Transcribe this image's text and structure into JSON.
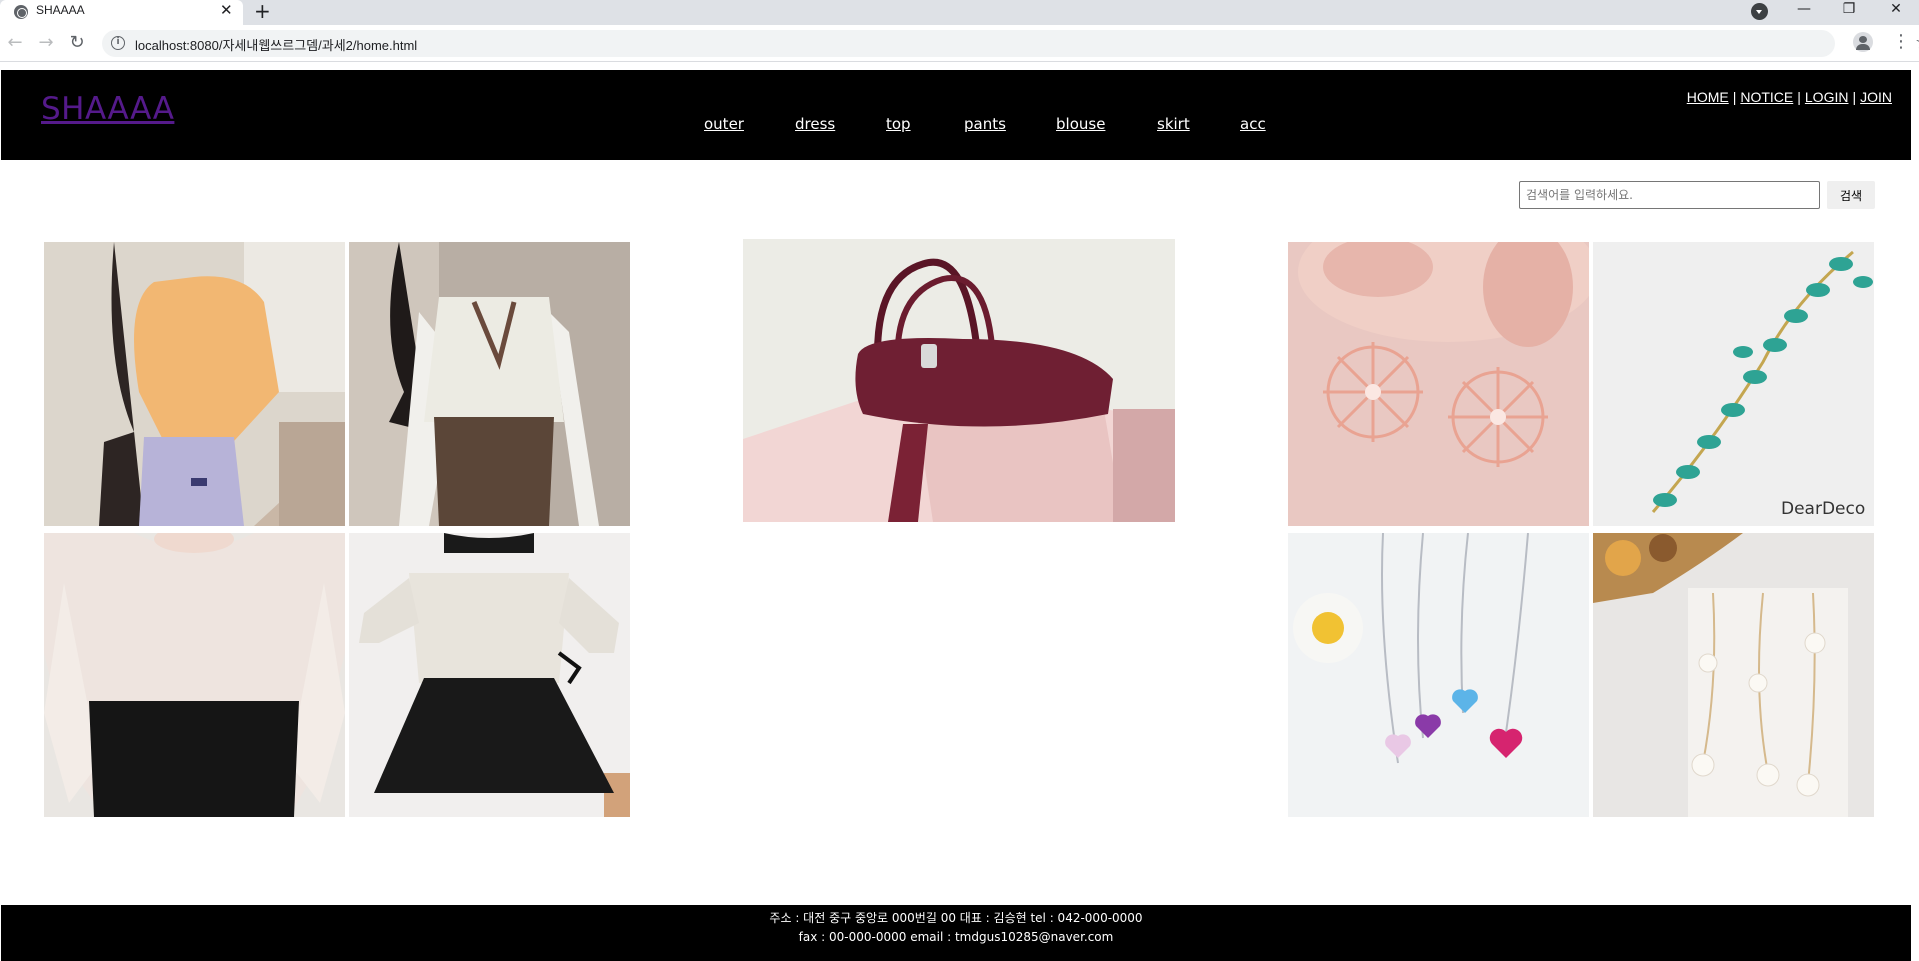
{
  "browser": {
    "tab_title": "SHAAAA",
    "tab_close": "✕",
    "new_tab": "+",
    "url": "localhost:8080/자세내웹쓰르그뎀/과세2/home.html",
    "window_controls": {
      "minimize": "—",
      "restore": "❐",
      "close": "✕"
    }
  },
  "header": {
    "logo": "SHAAAA",
    "util_links": [
      "HOME",
      "NOTICE",
      "LOGIN",
      "JOIN"
    ],
    "util_separator": "|",
    "categories": [
      "outer",
      "dress",
      "top",
      "pants",
      "blouse",
      "skirt",
      "acc"
    ]
  },
  "search": {
    "placeholder": "검색어를 입력하세요.",
    "button_label": "검색"
  },
  "gallery": {
    "left": [
      {
        "icon": "orange-sweater-outfit-photo"
      },
      {
        "icon": "knit-vest-outfit-photo"
      },
      {
        "icon": "white-blouse-outfit-photo"
      },
      {
        "icon": "lace-blouse-skirt-photo"
      }
    ],
    "center": {
      "icon": "burgundy-handbag-photo"
    },
    "right": [
      {
        "icon": "starburst-earrings-photo"
      },
      {
        "icon": "green-crystal-vine-photo",
        "watermark": "DearDeco"
      },
      {
        "icon": "heart-necklaces-photo"
      },
      {
        "icon": "pearl-earrings-photo"
      }
    ]
  },
  "footer": {
    "line1": "주소 : 대전 중구 중앙로 000번길 00 대표 : 김승현 tel : 042-000-0000",
    "line2": "fax : 00-000-0000 email : tmdgus10285@naver.com"
  }
}
